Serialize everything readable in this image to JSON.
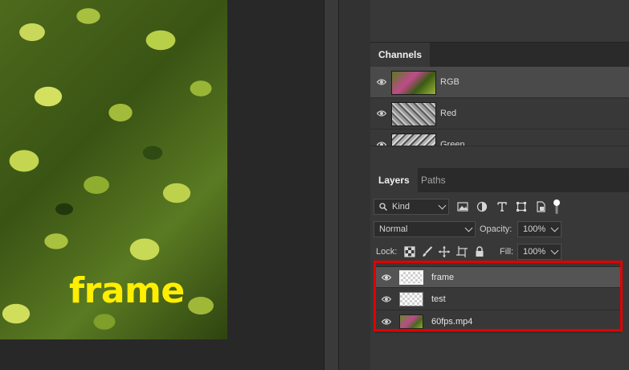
{
  "canvas": {
    "overlay_text": "frame",
    "overlay_color": "#ffee00"
  },
  "channels_panel": {
    "tab_label": "Channels",
    "channels": [
      {
        "name": "RGB",
        "selected": true
      },
      {
        "name": "Red",
        "selected": false
      },
      {
        "name": "Green",
        "selected": false
      }
    ]
  },
  "layers_panel": {
    "tabs": [
      {
        "label": "Layers",
        "active": true
      },
      {
        "label": "Paths",
        "active": false
      }
    ],
    "filter": {
      "value": "Kind"
    },
    "blend_mode": {
      "value": "Normal"
    },
    "opacity": {
      "label": "Opacity:",
      "value": "100%"
    },
    "lock": {
      "label": "Lock:"
    },
    "fill": {
      "label": "Fill:",
      "value": "100%"
    },
    "layers": [
      {
        "name": "frame",
        "selected": true,
        "thumb": "transparent"
      },
      {
        "name": "test",
        "selected": false,
        "thumb": "transparent"
      },
      {
        "name": "60fps.mp4",
        "selected": false,
        "thumb": "photo"
      }
    ]
  },
  "colors": {
    "highlight": "#e00000",
    "panel_bg": "#383838"
  }
}
